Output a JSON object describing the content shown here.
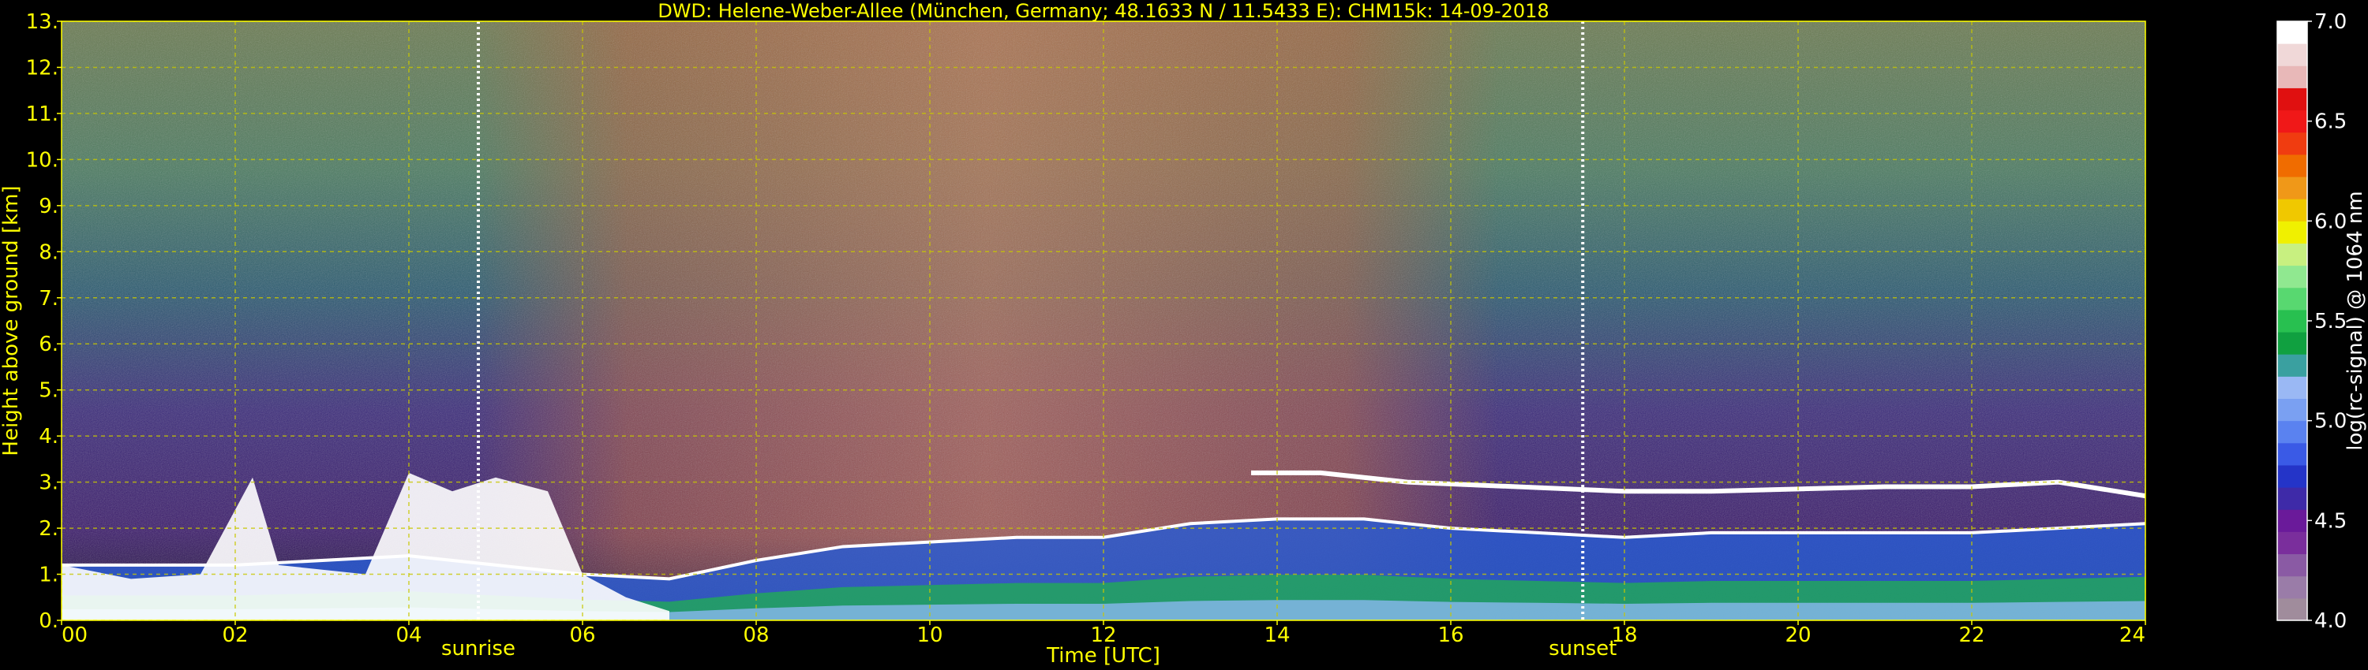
{
  "chart_data": {
    "type": "heatmap",
    "title": "DWD: Helene-Weber-Allee (München, Germany; 48.1633 N / 11.5433 E):    CHM15k: 14-09-2018",
    "xlabel": "Time [UTC]",
    "ylabel": "Height above ground [km]",
    "xlim": [
      0,
      24
    ],
    "ylim": [
      0,
      13
    ],
    "x_ticks": [
      "00",
      "02",
      "04",
      "06",
      "08",
      "10",
      "12",
      "14",
      "16",
      "18",
      "20",
      "22",
      "24"
    ],
    "y_ticks": [
      "0.",
      "1.",
      "2.",
      "3.",
      "4.",
      "5.",
      "6.",
      "7.",
      "8.",
      "9.",
      "10.",
      "11.",
      "12.",
      "13."
    ],
    "grid": true,
    "colorbar": {
      "label": "log(rc-signal) @ 1064 nm",
      "range": [
        4.0,
        7.0
      ],
      "ticks": [
        "4.0",
        "4.5",
        "5.0",
        "5.5",
        "6.0",
        "6.5",
        "7.0"
      ],
      "colors": [
        "#a08c9c",
        "#9a7ca8",
        "#8a5aa4",
        "#7a2e9c",
        "#6a1a9a",
        "#3e2aa8",
        "#2434c8",
        "#3a5ae6",
        "#5a82f0",
        "#7aa0f2",
        "#9ab8f4",
        "#3aa0a0",
        "#10a040",
        "#28c050",
        "#58d870",
        "#90e890",
        "#c8f080",
        "#f0f000",
        "#f0c800",
        "#f09818",
        "#f06c00",
        "#f03c10",
        "#f01818",
        "#e01010",
        "#e8b8b8",
        "#f0d8d8",
        "#ffffff"
      ]
    },
    "vertical_markers": [
      {
        "label": "sunrise",
        "x": 4.8
      },
      {
        "label": "sunset",
        "x": 17.52
      }
    ],
    "description_series": [
      {
        "name": "boundary layer top (km)",
        "x": [
          0,
          2,
          4,
          6,
          7,
          8,
          9,
          10,
          11,
          12,
          13,
          14,
          15,
          16,
          17,
          18,
          19,
          20,
          21,
          22,
          23,
          24
        ],
        "y": [
          1.2,
          1.2,
          1.4,
          1.0,
          0.9,
          1.3,
          1.6,
          1.7,
          1.8,
          1.8,
          2.1,
          2.2,
          2.2,
          2.0,
          1.9,
          1.8,
          1.9,
          1.9,
          1.9,
          1.9,
          2.0,
          2.1
        ]
      },
      {
        "name": "cloud layer (km)",
        "x": [
          13.7,
          14.5,
          15.5,
          18.0,
          19,
          20,
          21,
          22,
          23,
          24
        ],
        "y": [
          3.2,
          3.2,
          3.0,
          2.8,
          2.8,
          2.85,
          2.9,
          2.9,
          3.0,
          2.7
        ]
      }
    ]
  }
}
